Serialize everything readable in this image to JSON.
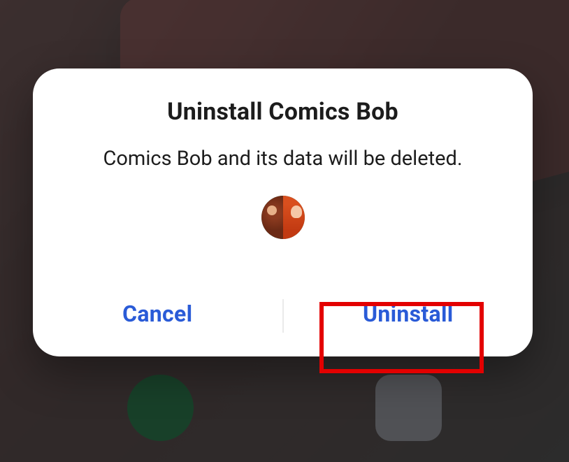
{
  "dialog": {
    "title": "Uninstall Comics Bob",
    "message": "Comics Bob and its data will be deleted.",
    "app_name": "Comics Bob",
    "buttons": {
      "cancel": "Cancel",
      "confirm": "Uninstall"
    }
  }
}
